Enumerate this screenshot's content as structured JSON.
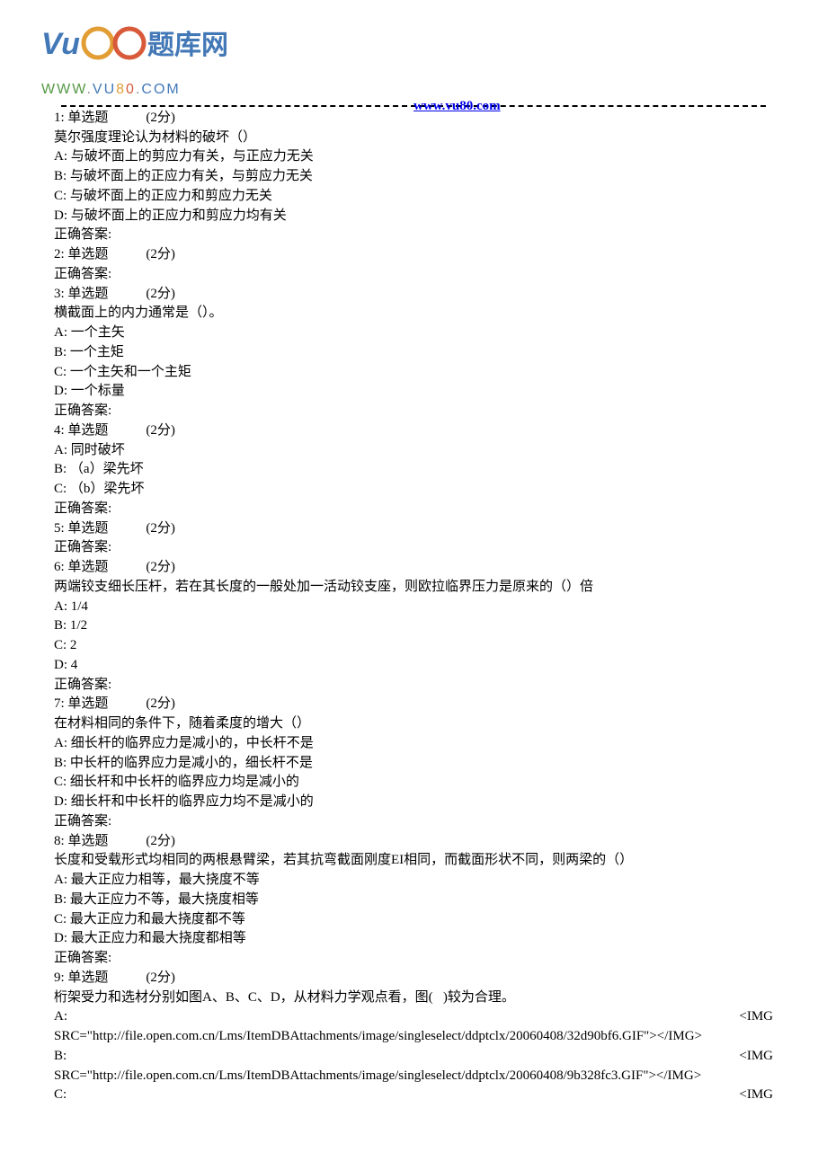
{
  "header": {
    "url": "www.vu80.com",
    "logo_text_cn": "80题库网",
    "logo_domain": "WWW.VU80.COM"
  },
  "q1": {
    "head": "1: 单选题",
    "points": "(2分)",
    "stem": "莫尔强度理论认为材料的破坏（）",
    "a": "A: 与破坏面上的剪应力有关，与正应力无关",
    "b": "B: 与破坏面上的正应力有关，与剪应力无关",
    "c": "C: 与破坏面上的正应力和剪应力无关",
    "d": "D: 与破坏面上的正应力和剪应力均有关",
    "ans": "正确答案:"
  },
  "q2": {
    "head": "2: 单选题",
    "points": "(2分)",
    "ans": "正确答案:"
  },
  "q3": {
    "head": "3: 单选题",
    "points": "(2分)",
    "stem": "横截面上的内力通常是（）。",
    "a": "A: 一个主矢",
    "b": "B: 一个主矩",
    "c": "C: 一个主矢和一个主矩",
    "d": "D: 一个标量",
    "ans": "正确答案:"
  },
  "q4": {
    "head": "4: 单选题",
    "points": "(2分)",
    "a": "A: 同时破坏",
    "b": "B: （a）梁先坏",
    "c": "C: （b）梁先坏",
    "ans": "正确答案:"
  },
  "q5": {
    "head": "5: 单选题",
    "points": "(2分)",
    "ans": "正确答案:"
  },
  "q6": {
    "head": "6: 单选题",
    "points": "(2分)",
    "stem": "两端铰支细长压杆，若在其长度的一般处加一活动铰支座，则欧拉临界压力是原来的（）倍",
    "a": "A: 1/4",
    "b": "B: 1/2",
    "c": "C: 2",
    "d": "D: 4",
    "ans": "正确答案:"
  },
  "q7": {
    "head": "7: 单选题",
    "points": "(2分)",
    "stem": "在材料相同的条件下，随着柔度的增大（）",
    "a": "A: 细长杆的临界应力是减小的，中长杆不是",
    "b": "B: 中长杆的临界应力是减小的，细长杆不是",
    "c": "C: 细长杆和中长杆的临界应力均是减小的",
    "d": "D: 细长杆和中长杆的临界应力均不是减小的",
    "ans": "正确答案:"
  },
  "q8": {
    "head": "8: 单选题",
    "points": "(2分)",
    "stem": "长度和受载形式均相同的两根悬臂梁，若其抗弯截面刚度EI相同，而截面形状不同，则两梁的（）",
    "a": "A: 最大正应力相等，最大挠度不等",
    "b": "B: 最大正应力不等，最大挠度相等",
    "c": "C: 最大正应力和最大挠度都不等",
    "d": "D: 最大正应力和最大挠度都相等",
    "ans": "正确答案:"
  },
  "q9": {
    "head": "9: 单选题",
    "points": "(2分)",
    "stem": "桁架受力和选材分别如图A、B、C、D，从材料力学观点看，图(   )较为合理。",
    "a_prefix": "A:",
    "a_img_tag": "<IMG",
    "a_src": "SRC=\"http://file.open.com.cn/Lms/ItemDBAttachments/image/singleselect/ddptclx/20060408/32d90bf6.GIF\"></IMG>",
    "b_prefix": "B:",
    "b_img_tag": "<IMG",
    "b_src": "SRC=\"http://file.open.com.cn/Lms/ItemDBAttachments/image/singleselect/ddptclx/20060408/9b328fc3.GIF\"></IMG>",
    "c_prefix": "C:",
    "c_img_tag": "<IMG"
  }
}
